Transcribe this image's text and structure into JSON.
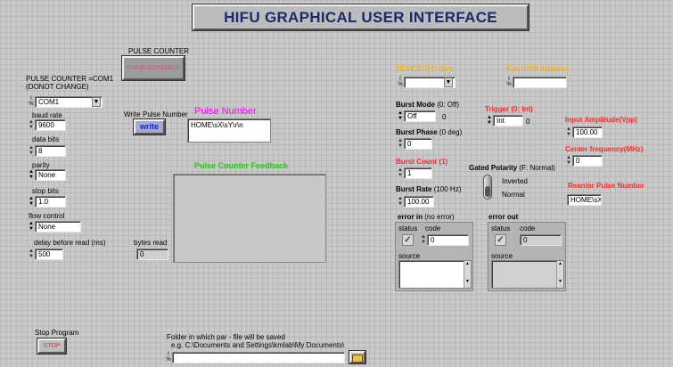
{
  "title": "HIFU GRAPHICAL USER INTERFACE",
  "pulse_counter": {
    "section_label": "PULSE COUNTER",
    "enable_button": "ENABLE/DISABLE",
    "port_note_line1": "PULSE COUNTER =COM1",
    "port_note_line2": "(DONOT CHANGE)",
    "port_value": "COM1",
    "baud_label": "baud rate",
    "baud_value": "9600",
    "data_bits_label": "data bits",
    "data_bits_value": "8",
    "parity_label": "parity",
    "parity_value": "None",
    "stop_bits_label": "stop bits",
    "stop_bits_value": "1.0",
    "flow_label": "flow control",
    "flow_value": "None",
    "delay_label": "delay before read (ms)",
    "delay_value": "500",
    "write_label": "Write",
    "pulse_number_small_label": "Pulse Number",
    "write_button": "write",
    "pulse_number_title": "Pulse Number",
    "pulse_number_value": "HOME\\sX\\sY\\r\\n",
    "feedback_title": "Pulse Counter Feedback",
    "bytes_read_label": "bytes read",
    "bytes_read_value": "0"
  },
  "device": {
    "device_label": "DEVICE  F(1) Gen",
    "gpib_label": "Fen GPIB Address",
    "burst_mode_label": "Burst Mode",
    "burst_mode_hint": "(0: Off)",
    "burst_mode_value": "Off",
    "burst_mode_num": "0",
    "burst_phase_label": "Burst Phase",
    "burst_phase_hint": "(0 deg)",
    "burst_phase_value": "0",
    "burst_count_label": "Burst Count (1)",
    "burst_count_value": "1",
    "burst_rate_label": "Burst Rate",
    "burst_rate_hint": "(100 Hz)",
    "burst_rate_value": "100.00",
    "trigger_label": "Trigger (0: Int)",
    "trigger_value": "Int",
    "trigger_num": "0",
    "gated_label": "Gated Polarity",
    "gated_hint": "(F: Normal)",
    "gated_option_inverted": "Inverted",
    "gated_option_normal": "Normal",
    "input_amp_label": "Input Amplitude(Vpp)",
    "input_amp_value": "100.00",
    "center_freq_label": "Center frequency(MHz)",
    "center_freq_value": "0",
    "reenter_label": "Reenter Pulse Number",
    "reenter_value": "HOME\\sX\\"
  },
  "error_in": {
    "title": "error in",
    "hint": "(no error)",
    "status_label": "status",
    "code_label": "code",
    "code_value": "0",
    "source_label": "source"
  },
  "error_out": {
    "title": "error out",
    "status_label": "status",
    "code_label": "code",
    "code_value": "0",
    "source_label": "source"
  },
  "stop": {
    "label": "Stop Program",
    "button": "STOP"
  },
  "folder": {
    "line1": "Folder in which par - file will be saved",
    "line2": "e.g. C:\\Documents and Settings\\kmlab\\My Documents\\",
    "value": ""
  },
  "icons": {
    "spin": "spin-icon",
    "dropdown": "chevron-down-icon",
    "folder": "folder-icon",
    "check": "checkmark-icon"
  }
}
